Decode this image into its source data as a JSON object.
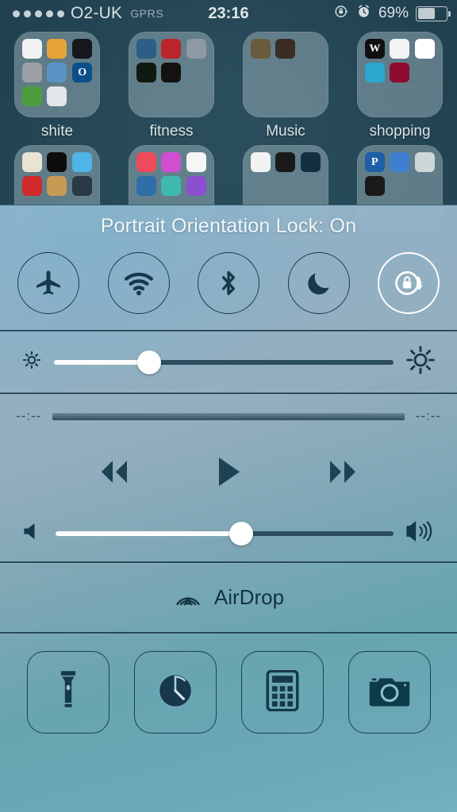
{
  "status_bar": {
    "signal_dots": 5,
    "carrier": "O2-UK",
    "network_type": "GPRS",
    "time": "23:16",
    "rotation_lock_icon": "rotation-lock-icon",
    "alarm_icon": "alarm-clock-icon",
    "battery_percent": "69%",
    "battery_level": 62,
    "text_color": "#d6dde0"
  },
  "home_screen": {
    "rows": [
      {
        "folders": [
          {
            "label": "shite",
            "apps": [
              {
                "name": "audio-waveform-app",
                "glyph": "",
                "color": "#f2f2f2"
              },
              {
                "name": "calculator-app",
                "glyph": "",
                "color": "#e8a23a"
              },
              {
                "name": "audio-analyzer-app",
                "glyph": "",
                "color": "#15171c"
              },
              {
                "name": "camera-app",
                "glyph": "",
                "color": "#9aa0a6"
              },
              {
                "name": "media-player-app",
                "glyph": "",
                "color": "#5b93c4"
              },
              {
                "name": "o2-app",
                "glyph": "O",
                "color": "#0b4f8a"
              },
              {
                "name": "photo-editor-app",
                "glyph": "",
                "color": "#4f9c3f"
              },
              {
                "name": "utility-app",
                "glyph": "",
                "color": "#e3e6e8"
              }
            ]
          },
          {
            "label": "fitness",
            "apps": [
              {
                "name": "weather-fitness-app",
                "glyph": "",
                "color": "#2d5f86"
              },
              {
                "name": "stopwatch-app",
                "glyph": "",
                "color": "#b9252b"
              },
              {
                "name": "speedometer-app",
                "glyph": "",
                "color": "#8d9aa3"
              },
              {
                "name": "heart-rate-app",
                "glyph": "",
                "color": "#111a12"
              },
              {
                "name": "runner-app",
                "glyph": "",
                "color": "#121212"
              }
            ]
          },
          {
            "label": "Music",
            "apps": [
              {
                "name": "music-maker-app",
                "glyph": "",
                "color": "#6b5a3c"
              },
              {
                "name": "drum-app",
                "glyph": "",
                "color": "#3b2c25"
              }
            ]
          },
          {
            "label": "shopping",
            "apps": [
              {
                "name": "wikipedia-app",
                "glyph": "W",
                "color": "#101010"
              },
              {
                "name": "ebay-app",
                "glyph": "",
                "color": "#f4f4f4"
              },
              {
                "name": "starbucks-app",
                "glyph": "",
                "color": "#ffffff"
              },
              {
                "name": "shopping-cart-app",
                "glyph": "",
                "color": "#2aa8cf"
              },
              {
                "name": "costa-app",
                "glyph": "",
                "color": "#8e0b32"
              }
            ]
          }
        ]
      },
      {
        "folders": [
          {
            "label": "",
            "apps": [
              {
                "name": "maps-app",
                "glyph": "",
                "color": "#e8e3d3"
              },
              {
                "name": "compass-app",
                "glyph": "",
                "color": "#0d0d0d"
              },
              {
                "name": "weather-app",
                "glyph": "",
                "color": "#4fb4e8"
              },
              {
                "name": "hiking-app",
                "glyph": "",
                "color": "#cf2b2b"
              },
              {
                "name": "board-game-app",
                "glyph": "",
                "color": "#c79a54"
              },
              {
                "name": "ball-app",
                "glyph": "",
                "color": "#2a3a44"
              }
            ]
          },
          {
            "label": "",
            "apps": [
              {
                "name": "itunes-app",
                "glyph": "",
                "color": "#ec4b5b"
              },
              {
                "name": "music-app",
                "glyph": "",
                "color": "#cf4fd0"
              },
              {
                "name": "photos-app",
                "glyph": "",
                "color": "#f6f6f6"
              },
              {
                "name": "video-app",
                "glyph": "",
                "color": "#2f6fa8"
              },
              {
                "name": "imovie-app",
                "glyph": "",
                "color": "#3fb8b0"
              },
              {
                "name": "podcasts-app",
                "glyph": "",
                "color": "#8b4fd0"
              }
            ]
          },
          {
            "label": "",
            "apps": [
              {
                "name": "game-center-app",
                "glyph": "",
                "color": "#f2f2f2"
              },
              {
                "name": "gta-app",
                "glyph": "",
                "color": "#1a1a1a"
              },
              {
                "name": "racing-game-app",
                "glyph": "",
                "color": "#12303f"
              }
            ]
          },
          {
            "label": "",
            "apps": [
              {
                "name": "paypal-app",
                "glyph": "P",
                "color": "#1f5fa8"
              },
              {
                "name": "network-app",
                "glyph": "",
                "color": "#3f7fd0"
              },
              {
                "name": "navigation-app",
                "glyph": "",
                "color": "#cfd6d8"
              },
              {
                "name": "free-app",
                "glyph": "",
                "color": "#1a1a1a"
              }
            ]
          }
        ]
      }
    ]
  },
  "control_center": {
    "banner": "Portrait Orientation Lock: On",
    "toggles": [
      {
        "name": "airplane-mode-toggle",
        "icon": "airplane-icon",
        "state": "off"
      },
      {
        "name": "wifi-toggle",
        "icon": "wifi-icon",
        "state": "off"
      },
      {
        "name": "bluetooth-toggle",
        "icon": "bluetooth-icon",
        "state": "off"
      },
      {
        "name": "do-not-disturb-toggle",
        "icon": "moon-icon",
        "state": "off"
      },
      {
        "name": "rotation-lock-toggle",
        "icon": "rotation-lock-icon",
        "state": "on"
      }
    ],
    "brightness": {
      "name": "brightness-slider",
      "value_percent": 28,
      "left_icon": "brightness-low-icon",
      "right_icon": "brightness-high-icon"
    },
    "playback": {
      "elapsed_time": "--:--",
      "remaining_time": "--:--",
      "progress_percent": 0,
      "controls": [
        {
          "name": "rewind-button",
          "icon": "rewind-icon"
        },
        {
          "name": "play-button",
          "icon": "play-icon"
        },
        {
          "name": "fast-forward-button",
          "icon": "fast-forward-icon"
        }
      ]
    },
    "volume": {
      "name": "volume-slider",
      "value_percent": 55,
      "left_icon": "volume-low-icon",
      "right_icon": "volume-high-icon"
    },
    "airdrop": {
      "label": "AirDrop",
      "icon": "airdrop-icon"
    },
    "shortcuts": [
      {
        "name": "flashlight-button",
        "icon": "flashlight-icon"
      },
      {
        "name": "timer-button",
        "icon": "timer-icon"
      },
      {
        "name": "calculator-button",
        "icon": "calculator-icon"
      },
      {
        "name": "camera-button",
        "icon": "camera-icon"
      }
    ],
    "colors": {
      "icon_dark": "#16384a",
      "active_white": "#ffffff",
      "separator": "#102e3d",
      "banner_text": "#f2f7f9"
    }
  }
}
